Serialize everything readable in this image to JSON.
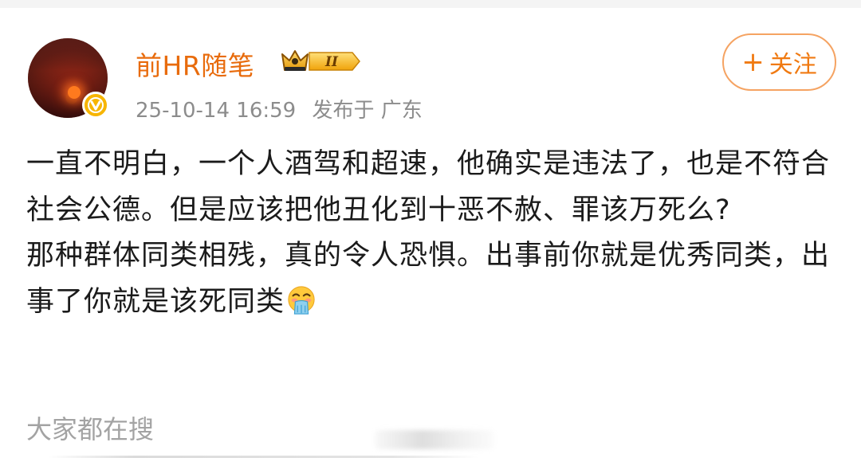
{
  "author": {
    "name": "前HR随笔",
    "vip_level": "II",
    "avatar_icon": "sunset-avatar",
    "verified_icon": "verified-v-icon"
  },
  "post": {
    "date": "25-10-14 16:59",
    "location": "发布于 广东",
    "paragraphs": [
      "一直不明白，一个人酒驾和超速，他确实是违法了，也是不符合社会公德。但是应该把他丑化到十恶不赦、罪该万死么?",
      "那种群体同类相残，真的令人恐惧。出事前你就是优秀同类，出事了你就是该死同类"
    ],
    "emoji": "vomit-face-emoji"
  },
  "follow": {
    "plus": "+",
    "label": "关注"
  },
  "section": {
    "search_title": "大家都在搜"
  },
  "colors": {
    "accent": "#e86b0c",
    "follow_border": "#f5a362",
    "meta_gray": "#8c8c8c",
    "vip_gold": "#f5b614"
  }
}
